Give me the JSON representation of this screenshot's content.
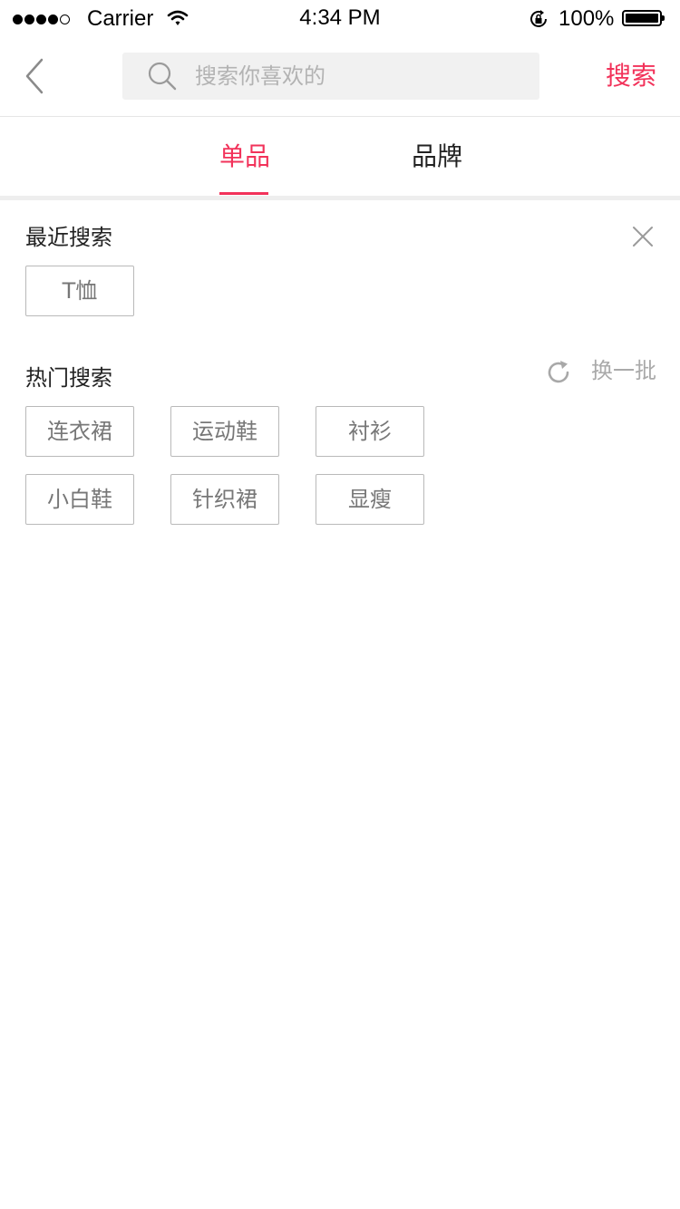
{
  "status_bar": {
    "carrier": "Carrier",
    "time": "4:34 PM",
    "battery": "100%",
    "signal_bars_filled": 4,
    "signal_bars_total": 5
  },
  "nav": {
    "search_placeholder": "搜索你喜欢的",
    "search_button": "搜索"
  },
  "tabs": [
    {
      "label": "单品",
      "active": true
    },
    {
      "label": "品牌",
      "active": false
    }
  ],
  "recent": {
    "title": "最近搜索",
    "tags": [
      "T恤"
    ]
  },
  "hot": {
    "title": "热门搜索",
    "refresh_label": "换一批",
    "tags": [
      "连衣裙",
      "运动鞋",
      "衬衫",
      "小白鞋",
      "针织裙",
      "显瘦"
    ]
  },
  "colors": {
    "accent": "#f2325a",
    "tag_border": "#b9b9b9",
    "tag_text": "#777777",
    "muted_text": "#aaaaaa",
    "search_bg": "#f1f1f1"
  },
  "icons": {
    "back": "chevron-left-icon",
    "search": "search-icon",
    "clear": "close-icon",
    "refresh": "refresh-icon",
    "wifi": "wifi-icon",
    "rotation_lock": "rotation-lock-icon",
    "battery": "battery-icon"
  }
}
